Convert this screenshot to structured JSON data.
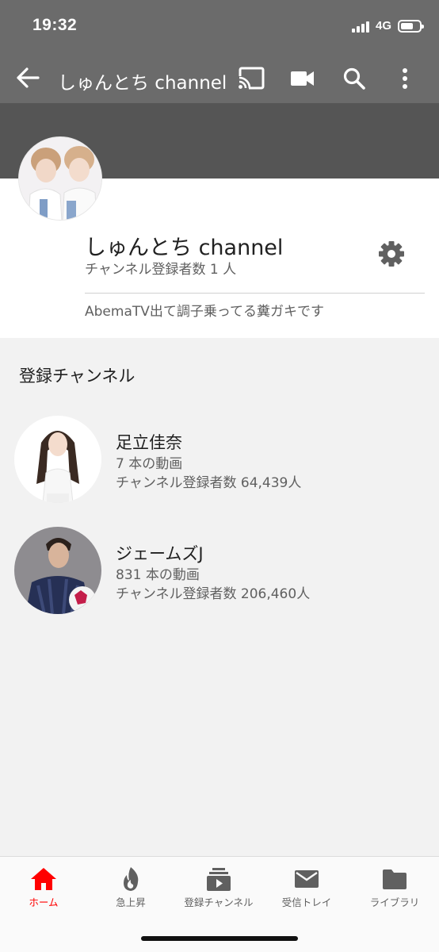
{
  "status_bar": {
    "time": "19:32",
    "network": "4G",
    "battery_level": 0.7
  },
  "app_bar": {
    "title": "しゅんとち channel",
    "icons": [
      "back-arrow-icon",
      "cast-icon",
      "video-camera-icon",
      "search-icon",
      "more-vert-icon"
    ]
  },
  "channel": {
    "name": "しゅんとち channel",
    "subscribers": "チャンネル登録者数 1 人",
    "description": "AbemaTV出て調子乗ってる糞ガキです"
  },
  "subscriptions": {
    "title": "登録チャンネル",
    "items": [
      {
        "name": "足立佳奈",
        "videos": "7 本の動画",
        "subscribers": "チャンネル登録者数 64,439人"
      },
      {
        "name": "ジェームズJ",
        "videos": "831 本の動画",
        "subscribers": "チャンネル登録者数 206,460人"
      }
    ]
  },
  "bottom_nav": {
    "items": [
      {
        "label": "ホーム",
        "icon": "home-icon",
        "active": true
      },
      {
        "label": "急上昇",
        "icon": "flame-icon",
        "active": false
      },
      {
        "label": "登録チャンネル",
        "icon": "subscriptions-icon",
        "active": false
      },
      {
        "label": "受信トレイ",
        "icon": "mail-icon",
        "active": false
      },
      {
        "label": "ライブラリ",
        "icon": "folder-icon",
        "active": false
      }
    ]
  },
  "colors": {
    "app_bar": "#6b6b6b",
    "banner": "#555555",
    "active": "#ff0000",
    "background": "#f2f2f2"
  }
}
